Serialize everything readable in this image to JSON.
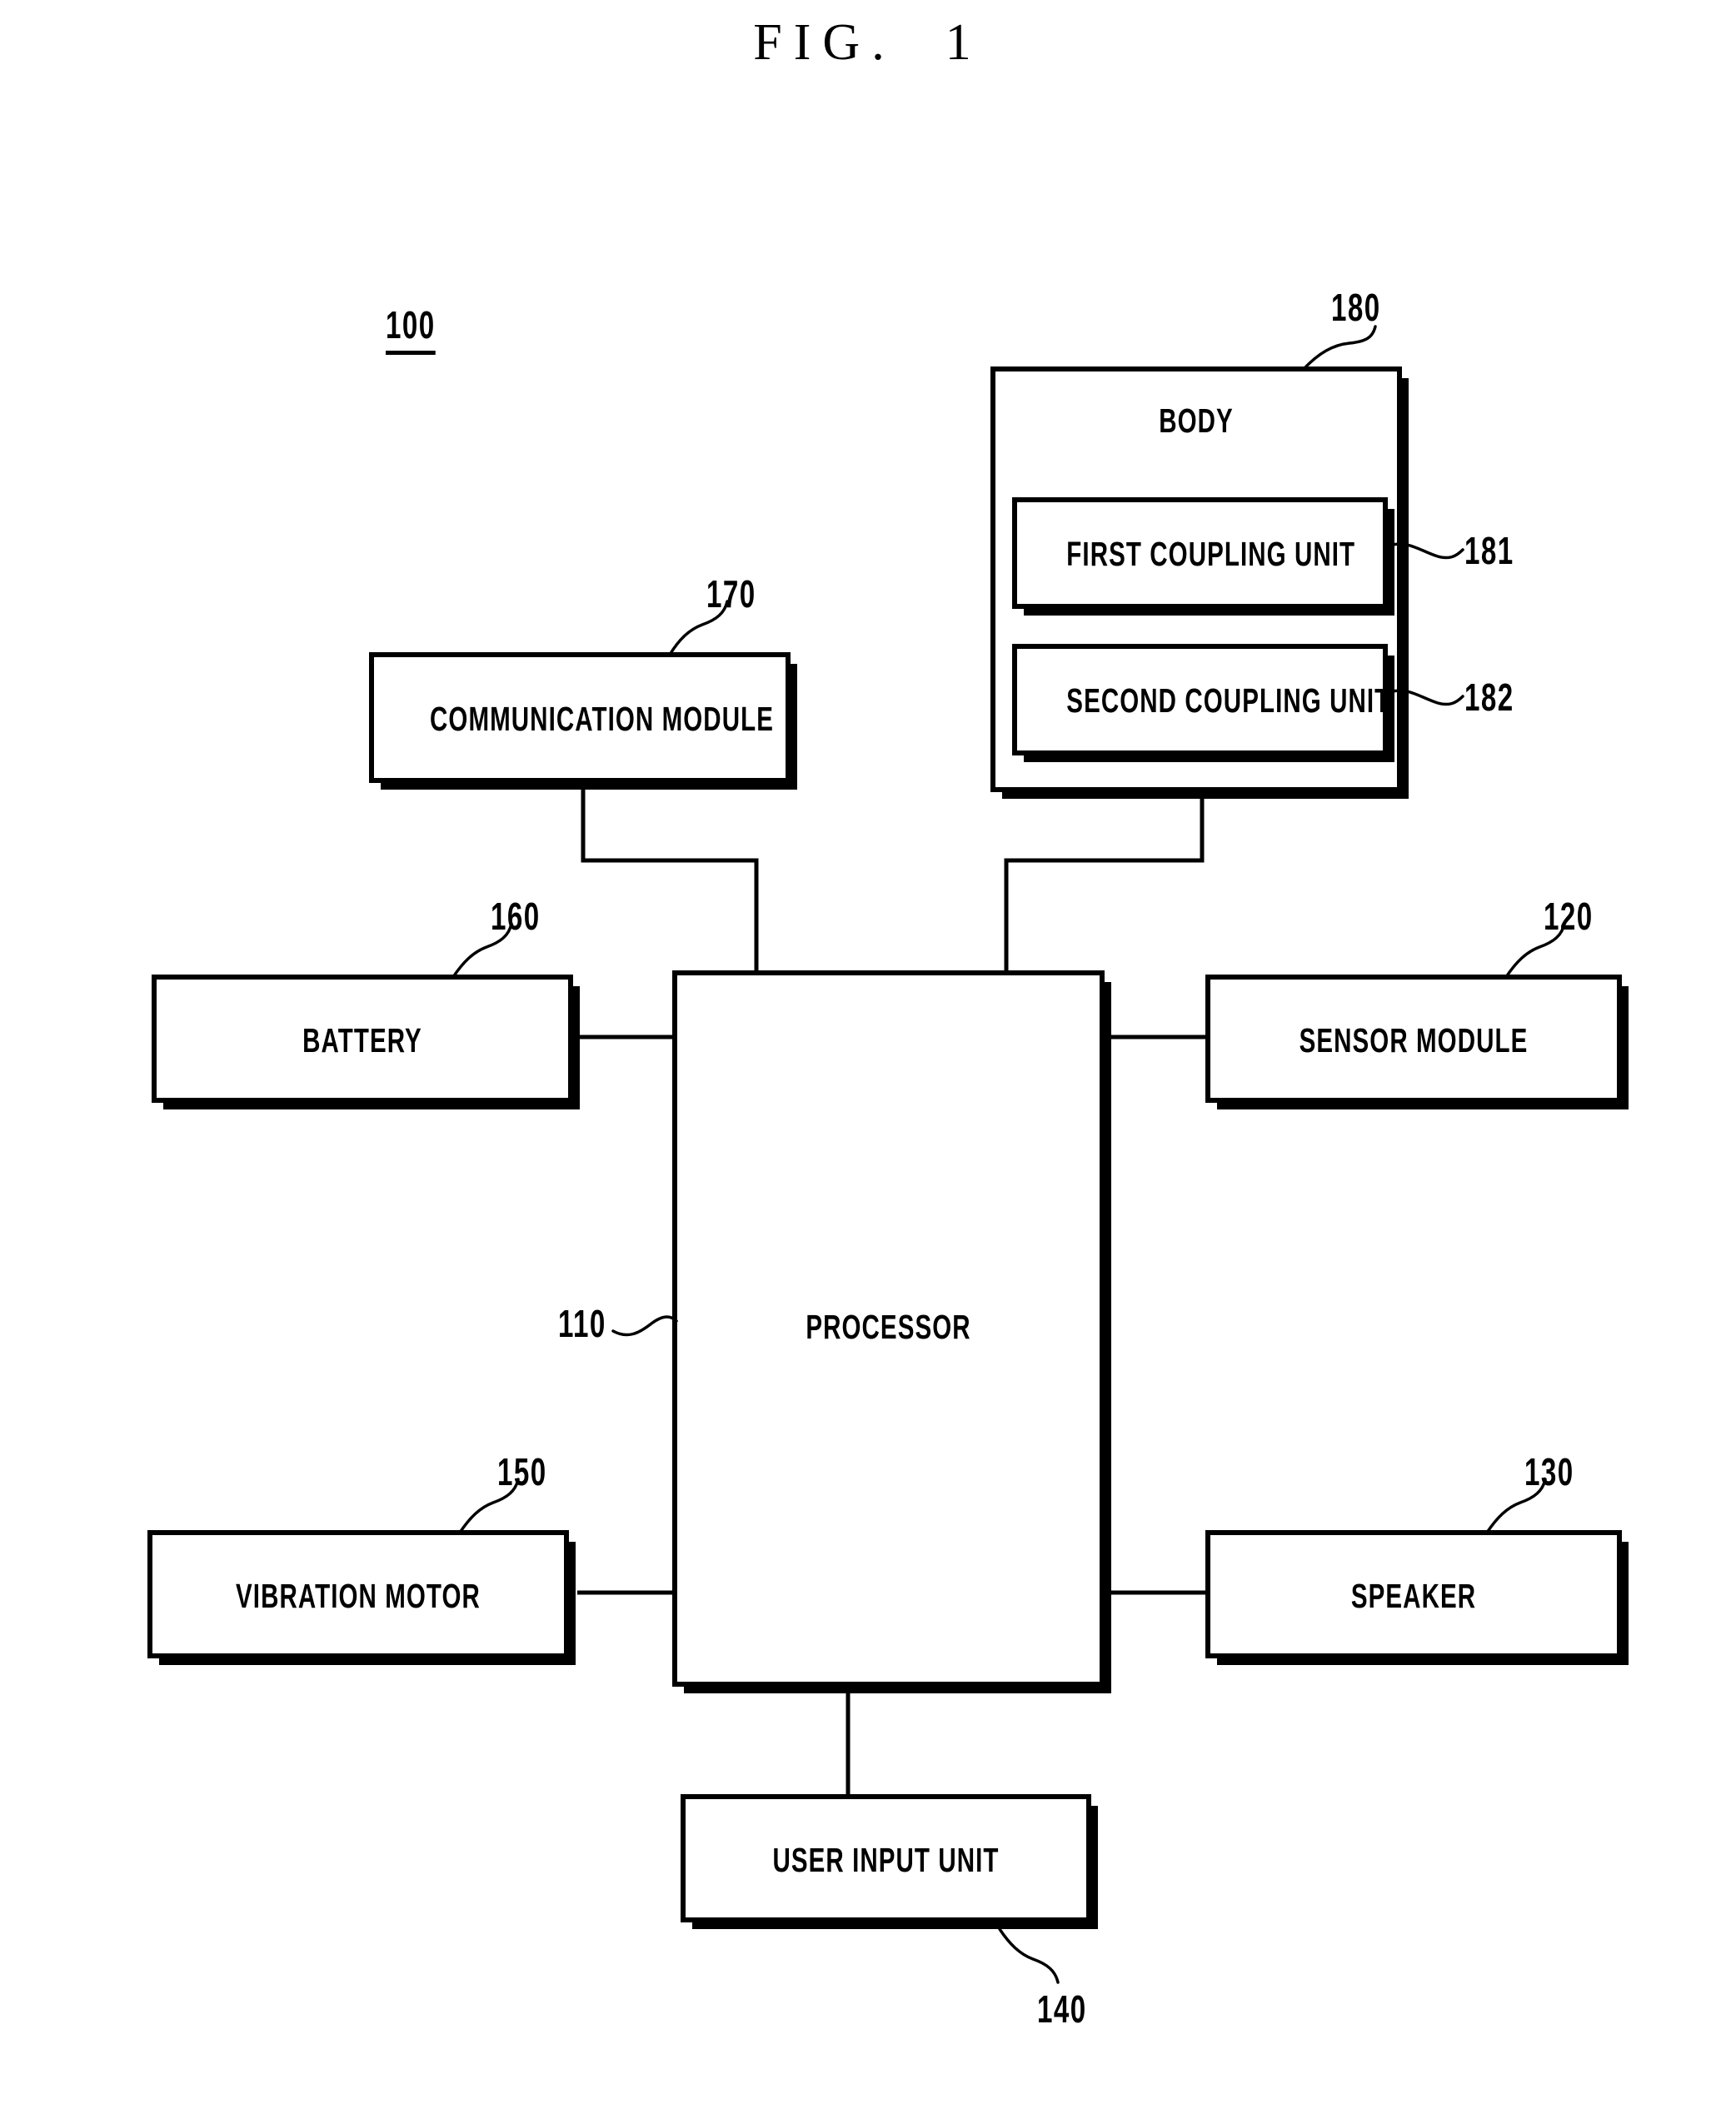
{
  "figure": {
    "title": "FIG.  1",
    "system_ref": "100"
  },
  "blocks": {
    "body": {
      "label": "BODY",
      "ref": "180",
      "children": [
        {
          "label": "FIRST COUPLING UNIT",
          "ref": "181"
        },
        {
          "label": "SECOND COUPLING UNIT",
          "ref": "182"
        }
      ]
    },
    "communication_module": {
      "label": "COMMUNICATION MODULE",
      "ref": "170"
    },
    "battery": {
      "label": "BATTERY",
      "ref": "160"
    },
    "sensor_module": {
      "label": "SENSOR MODULE",
      "ref": "120"
    },
    "processor": {
      "label": "PROCESSOR",
      "ref": "110"
    },
    "vibration_motor": {
      "label": "VIBRATION MOTOR",
      "ref": "150"
    },
    "speaker": {
      "label": "SPEAKER",
      "ref": "130"
    },
    "user_input_unit": {
      "label": "USER INPUT UNIT",
      "ref": "140"
    }
  },
  "style": {
    "line_color": "#000000",
    "fill_color": "#ffffff",
    "background": "#ffffff"
  }
}
